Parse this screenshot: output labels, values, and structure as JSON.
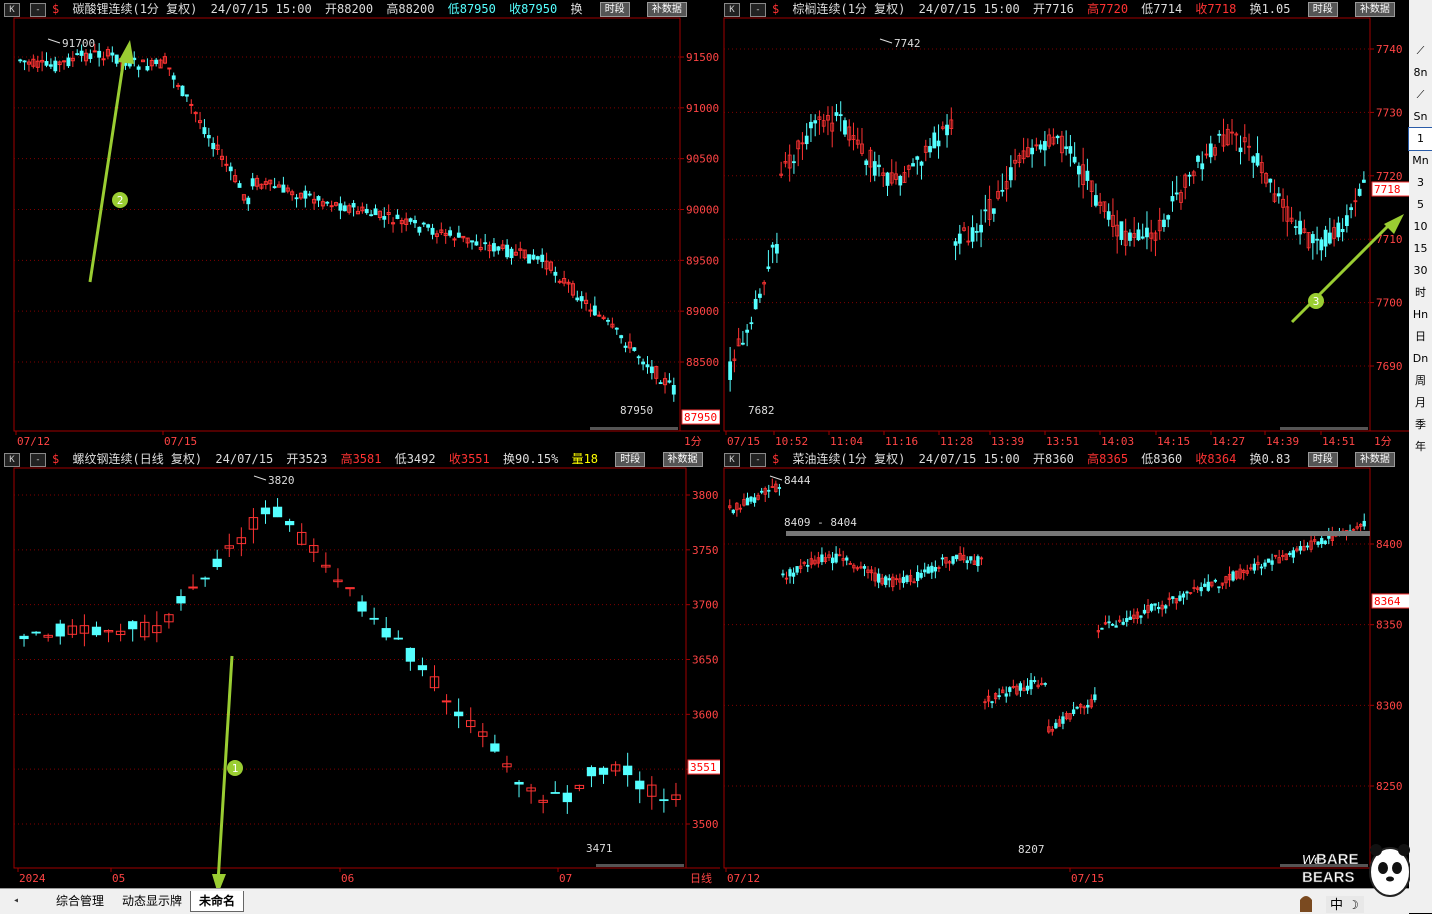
{
  "panels": [
    {
      "id": "p1",
      "title": "碳酸锂连续(1分 复权)",
      "date": "24/07/15 15:00",
      "open": "开88200",
      "high": "高88200",
      "low": "低87950",
      "close": "收87950",
      "extra": "换",
      "btn1": "时段",
      "btn2": "补数据",
      "y_ticks": [
        "91500",
        "91000",
        "90500",
        "90000",
        "89500",
        "89000",
        "88500"
      ],
      "x_ticks": [
        "07/12",
        "07/15"
      ],
      "period": "1分",
      "max_label": "91700",
      "min_label": "87950",
      "last_price": "87950",
      "annotation": "2"
    },
    {
      "id": "p2",
      "title": "棕榈连续(1分 复权)",
      "date": "24/07/15 15:00",
      "open": "开7716",
      "high": "高7720",
      "low": "低7714",
      "close": "收7718",
      "extra": "换1.05",
      "btn1": "时段",
      "btn2": "补数据",
      "y_ticks": [
        "7740",
        "7730",
        "7720",
        "7710",
        "7700",
        "7690"
      ],
      "x_ticks": [
        "07/15",
        "10:52",
        "11:04",
        "11:16",
        "11:28",
        "13:39",
        "13:51",
        "14:03",
        "14:15",
        "14:27",
        "14:39",
        "14:51"
      ],
      "period": "1分",
      "max_label": "7742",
      "min_label": "7682",
      "last_price": "7718",
      "annotation": "3"
    },
    {
      "id": "p3",
      "title": "螺纹钢连续(日线 复权)",
      "date": "24/07/15",
      "open": "开3523",
      "high": "高3581",
      "low": "低3492",
      "close": "收3551",
      "extra": "换90.15%",
      "vol": "量18",
      "btn1": "时段",
      "btn2": "补数据",
      "y_ticks": [
        "3800",
        "3750",
        "3700",
        "3650",
        "3600",
        "3550",
        "3500"
      ],
      "x_ticks": [
        "2024",
        "05",
        "06",
        "07"
      ],
      "period": "日线",
      "max_label": "3820",
      "min_label": "3471",
      "last_price": "3551",
      "annotation": "1"
    },
    {
      "id": "p4",
      "title": "菜油连续(1分 复权)",
      "date": "24/07/15 15:00",
      "open": "开8360",
      "high": "高8365",
      "low": "低8360",
      "close": "收8364",
      "extra": "换0.83",
      "btn1": "时段",
      "btn2": "补数据",
      "y_ticks": [
        "8400",
        "8350",
        "8300",
        "8250"
      ],
      "x_ticks": [
        "07/12",
        "07/15"
      ],
      "period": "",
      "max_label": "8444",
      "min_label": "8207",
      "last_price": "8364",
      "range_label": "8409 - 8404"
    }
  ],
  "toolbar": [
    "⟋",
    "8n",
    "⟋",
    "Sn",
    "1",
    "Mn",
    "3",
    "5",
    "10",
    "15",
    "30",
    "时",
    "Hn",
    "日",
    "Dn",
    "周",
    "月",
    "季",
    "年"
  ],
  "tabs": [
    "综合管理",
    "动态显示牌",
    "未命名"
  ],
  "mascot": {
    "line1": "We",
    "line2": "BARE",
    "line3": "BEARS",
    "badge": "中"
  },
  "colors": {
    "up": "#ff3333",
    "down": "#55ffff",
    "grid": "#800000",
    "frame": "#a00000",
    "annot": "#9acd32"
  }
}
